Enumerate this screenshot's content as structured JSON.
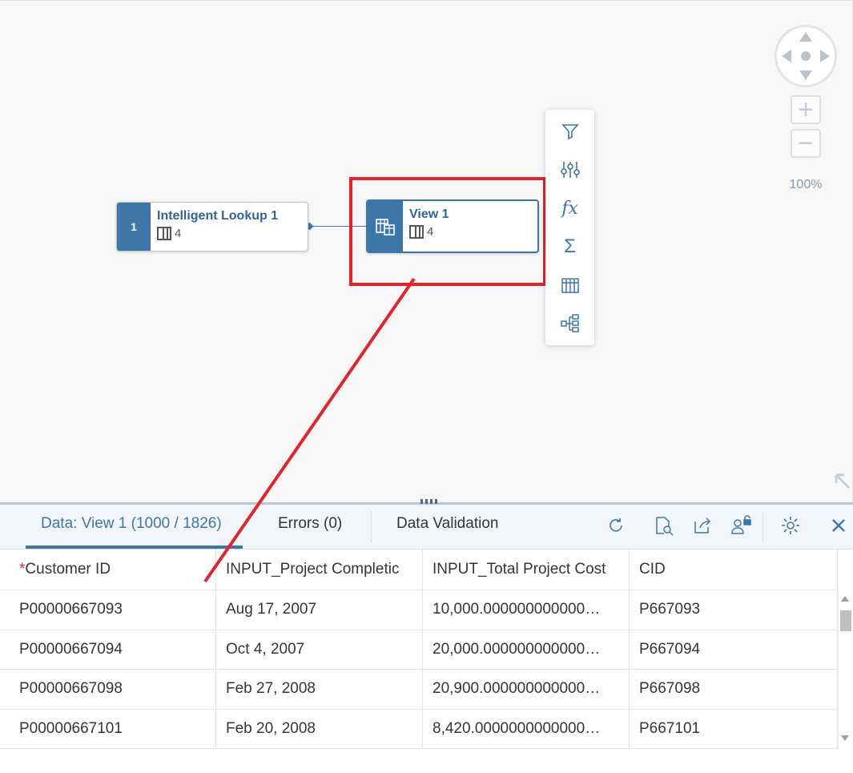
{
  "canvas": {
    "zoom_level": "100%",
    "nodes": [
      {
        "index": "1",
        "title": "Intelligent Lookup 1",
        "column_count": "4"
      },
      {
        "title": "View 1",
        "column_count": "4"
      }
    ],
    "palette_tools": [
      "filter-icon",
      "adjust-icon",
      "formula-icon",
      "sum-icon",
      "columns-icon",
      "hierarchy-icon"
    ]
  },
  "panel": {
    "tabs": {
      "data": "Data: View 1 (1000 / 1826)",
      "errors": "Errors (0)",
      "validation": "Data Validation"
    },
    "columns": [
      "Customer ID",
      "INPUT_Project Completic",
      "INPUT_Total Project Cost",
      "CID"
    ],
    "required_marker": "*",
    "rows": [
      [
        "P00000667093",
        "Aug 17, 2007",
        "10,000.000000000000…",
        "P667093"
      ],
      [
        "P00000667094",
        "Oct 4, 2007",
        "20,000.000000000000…",
        "P667094"
      ],
      [
        "P00000667098",
        "Feb 27, 2008",
        "20,900.000000000000…",
        "P667098"
      ],
      [
        "P00000667101",
        "Feb 20, 2008",
        "8,420.0000000000000…",
        "P667101"
      ]
    ]
  },
  "colors": {
    "accent": "#3f76a8",
    "highlight": "#e3242b"
  }
}
